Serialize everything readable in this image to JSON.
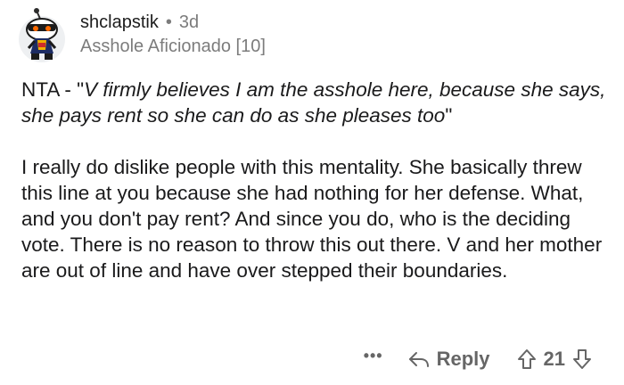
{
  "comment": {
    "username": "shclapstik",
    "separator": "•",
    "age": "3d",
    "flair": "Asshole Aficionado [10]",
    "paragraphs": [
      {
        "prefix": "NTA - \"",
        "quote": "V firmly believes I am the asshole here, because she says, she pays rent so she can do as she pleases too",
        "suffix": "\""
      },
      {
        "text": "I really do dislike people with this mentality.  She basically threw this line at you because she had nothing for her defense.  What, and you don't pay rent?  And since you do, who is the deciding vote.  There is no reason to throw this out there.  V and her mother are out of line and have over stepped their boundaries."
      }
    ],
    "footer": {
      "more_label": "•••",
      "reply_label": "Reply",
      "score": "21"
    }
  },
  "icons": {
    "avatar": "snoo-avatar",
    "reply": "reply-arrow-icon",
    "upvote": "upvote-arrow-icon",
    "downvote": "downvote-arrow-icon"
  },
  "colors": {
    "text": "#1a1a1b",
    "muted": "#7c7c7c",
    "footer": "#666666",
    "avatar_bg": "#eef0f2"
  }
}
